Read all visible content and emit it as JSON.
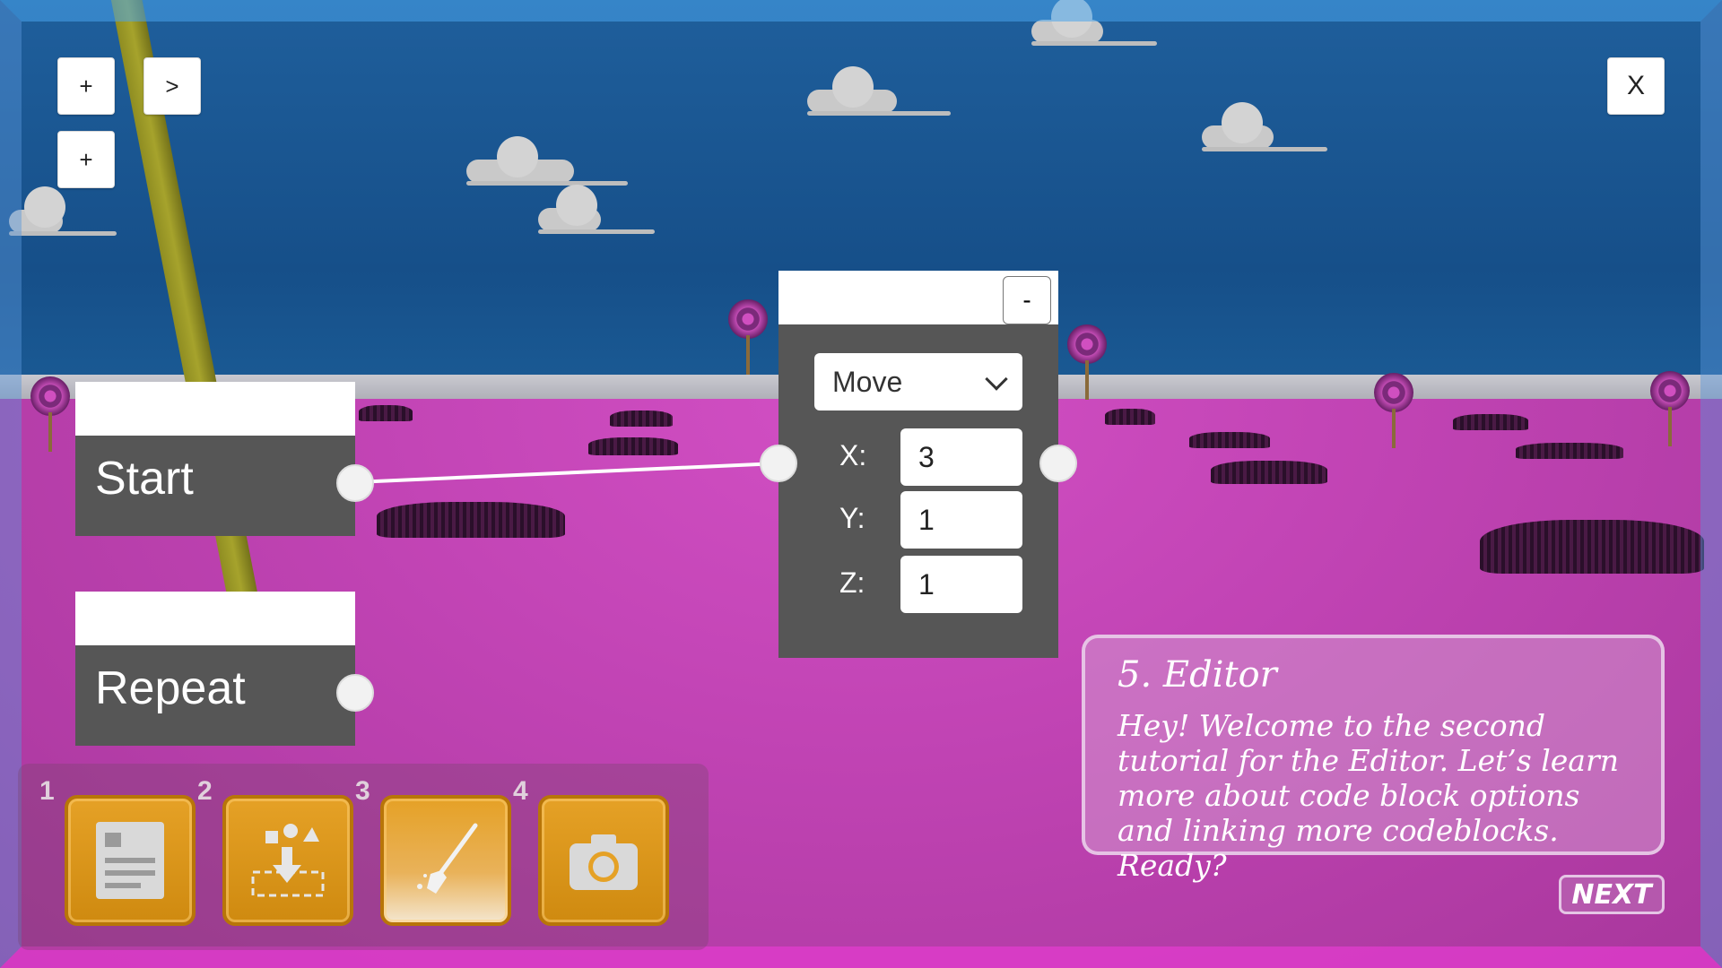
{
  "top_controls": {
    "add_label_1": "+",
    "next_label": ">",
    "add_label_2": "+",
    "close_label": "X"
  },
  "blocks": {
    "start": {
      "label": "Start"
    },
    "repeat": {
      "label": "Repeat"
    },
    "move": {
      "collapse_label": "-",
      "action_selected": "Move",
      "x_label": "X:",
      "x_value": "3",
      "y_label": "Y:",
      "y_value": "1",
      "z_label": "Z:",
      "z_value": "1"
    }
  },
  "toolbar": {
    "slots": [
      {
        "number": "1",
        "icon": "document-icon"
      },
      {
        "number": "2",
        "icon": "place-object-icon"
      },
      {
        "number": "3",
        "icon": "paint-brush-icon"
      },
      {
        "number": "4",
        "icon": "camera-icon"
      }
    ]
  },
  "tutorial": {
    "title": "5. Editor",
    "body": "Hey! Welcome to the second tutorial for the Editor. Let’s learn more about code block options and linking more codeblocks. Ready?",
    "next_label": "NEXT"
  },
  "colors": {
    "sky": "#164f89",
    "ground": "#c043b3",
    "block_body": "#565656",
    "tool_button": "#e5a126"
  }
}
